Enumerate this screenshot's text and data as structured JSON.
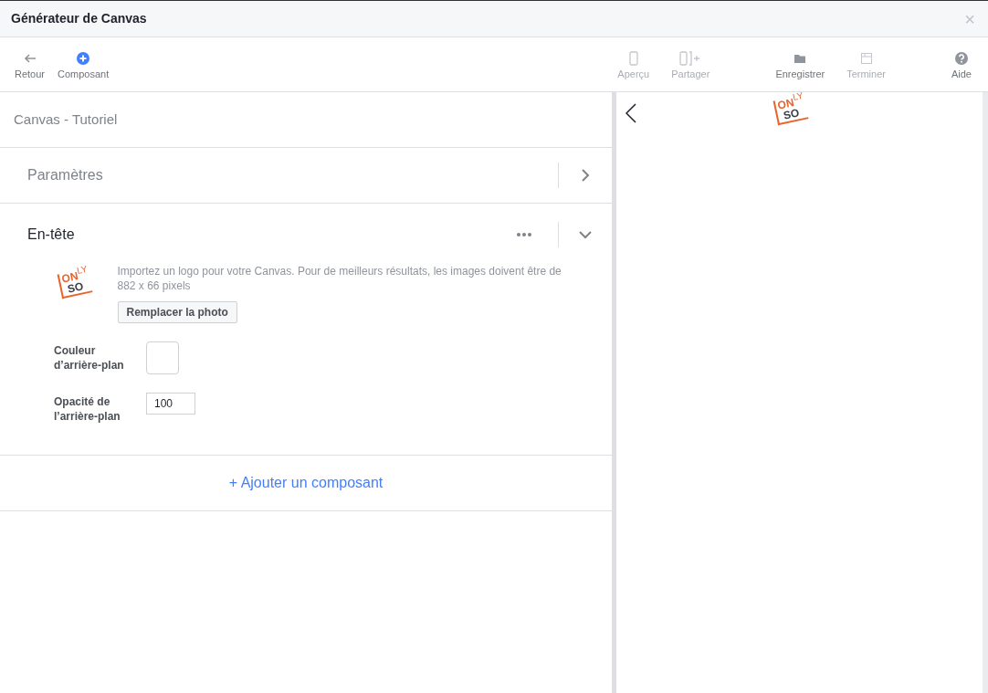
{
  "window": {
    "title": "Générateur de Canvas",
    "close": "×"
  },
  "toolbar": {
    "left": [
      {
        "kind": "back",
        "label": "Retour",
        "disabled": false
      },
      {
        "kind": "add",
        "label": "Composant",
        "disabled": false
      }
    ],
    "right": [
      {
        "kind": "phone",
        "label": "Aperçu",
        "disabled": true
      },
      {
        "kind": "share",
        "label": "Partager",
        "disabled": true
      },
      {
        "kind": "folder",
        "label": "Enregistrer",
        "disabled": false
      },
      {
        "kind": "finish",
        "label": "Terminer",
        "disabled": true
      },
      {
        "kind": "help",
        "label": "Aide",
        "disabled": false
      }
    ]
  },
  "editor": {
    "canvas_name": "Canvas - Tutoriel",
    "sections": [
      {
        "title": "Paramètres",
        "expanded": false
      },
      {
        "title": "En-tête",
        "expanded": true
      }
    ],
    "header": {
      "logo": {
        "top": "ON",
        "corner": "LY",
        "bottom": "SO"
      },
      "hint": "Importez un logo pour votre Canvas. Pour de meilleurs résultats, les images doivent être de 882 x 66 pixels",
      "replace_button": "Remplacer la photo",
      "background_color_label": "Couleur d’arrière-plan",
      "opacity_label": "Opacité de l’arrière-plan",
      "opacity_value": "100"
    },
    "add_component": "+ Ajouter un composant"
  },
  "preview": {
    "logo": {
      "top": "ON",
      "corner": "LY",
      "bottom": "SO"
    }
  }
}
